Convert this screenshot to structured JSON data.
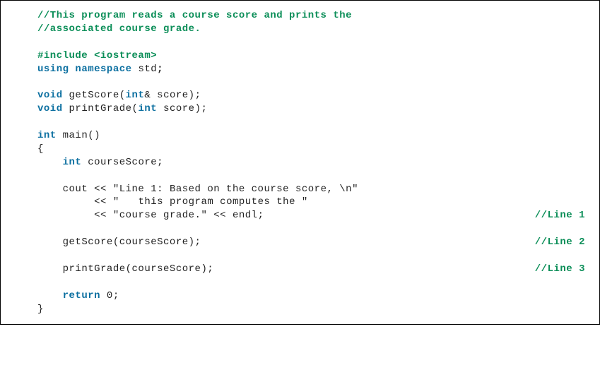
{
  "code": {
    "c1": "//This program reads a course score and prints the",
    "c2": "//associated course grade.",
    "pp": "#include <iostream>",
    "kw_using": "using",
    "kw_namespace": "namespace",
    "id_std": "std",
    "kw_void": "void",
    "id_getScore_decl": "getScore(",
    "kw_int": "int",
    "id_amp_score": "& score);",
    "id_printGrade_decl": "printGrade(",
    "id_score_paren": "score);",
    "id_main_decl": "main()",
    "lbrace": "{",
    "rbrace": "}",
    "id_courseScore_decl": "courseScore;",
    "id_cout": "cout << ",
    "str_line1a": "\"Line 1: Based on the course score, \\n\"",
    "id_lshift": "<< ",
    "str_line1b": "\"   this program computes the \"",
    "str_line1c": "\"course grade.\"",
    "id_endl": " << endl;",
    "id_getScore_call": "getScore(courseScore);",
    "id_printGrade_call": "printGrade(courseScore);",
    "kw_return": "return",
    "lit_zero": " 0;",
    "semi": ";"
  },
  "comments": {
    "l1": "//Line 1",
    "l2": "//Line 2",
    "l3": "//Line 3"
  }
}
